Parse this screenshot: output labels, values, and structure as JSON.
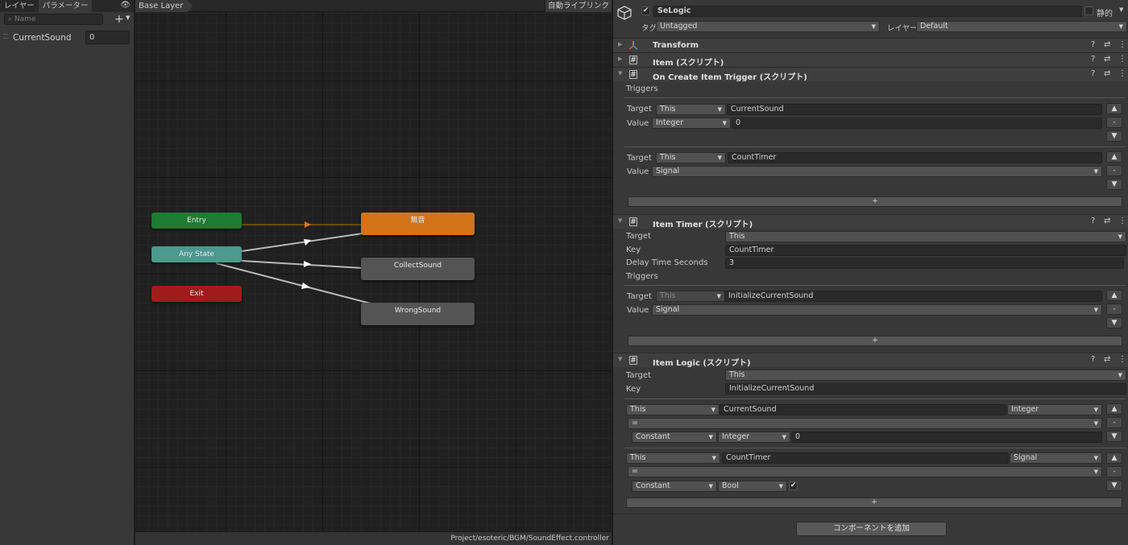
{
  "left_panel": {
    "tab_layers": "レイヤー",
    "tab_parameters": "パラメーター",
    "search_placeholder": "Name",
    "add_label": "+",
    "parameters": [
      {
        "name": "CurrentSound",
        "value": "0"
      }
    ]
  },
  "graph": {
    "breadcrumb": "Base Layer",
    "auto_live_link": "自動ライブリンク",
    "path": "Project/esoteric/BGM/SoundEffect.controller",
    "nodes": {
      "entry": "Entry",
      "any_state": "Any State",
      "exit": "Exit",
      "silent": "無音",
      "collect": "CollectSound",
      "wrong": "WrongSound"
    },
    "colors": {
      "entry": "#1f7a32",
      "any_state": "#4a9a8e",
      "exit": "#a01c1c",
      "default_state": "#d4731a",
      "state": "#545454"
    }
  },
  "inspector": {
    "object_name": "SeLogic",
    "static_label": "静的",
    "tag_label": "タグ",
    "tag_value": "Untagged",
    "layer_label": "レイヤー",
    "layer_value": "Default",
    "components": {
      "transform": "Transform",
      "item": "Item (スクリプト)",
      "on_create": "On Create Item Trigger (スクリプト)",
      "timer": "Item Timer (スクリプト)",
      "logic": "Item Logic (スクリプト)"
    },
    "on_create": {
      "triggers_label": "Triggers",
      "target_label": "Target",
      "value_label": "Value",
      "t1_target": "This",
      "t1_key": "CurrentSound",
      "t1_type": "Integer",
      "t1_value": "0",
      "t2_target": "This",
      "t2_key": "CountTimer",
      "t2_type": "Signal",
      "plus": "+"
    },
    "timer": {
      "target_label": "Target",
      "target_value": "This",
      "key_label": "Key",
      "key_value": "CountTimer",
      "delay_label": "Delay Time Seconds",
      "delay_value": "3",
      "triggers_label": "Triggers",
      "tr_target_label": "Target",
      "tr_target": "This",
      "tr_key": "InitializeCurrentSound",
      "tr_value_label": "Value",
      "tr_type": "Signal",
      "plus": "+"
    },
    "logic": {
      "target_label": "Target",
      "target_value": "This",
      "key_label": "Key",
      "key_value": "InitializeCurrentSound",
      "c1_target": "This",
      "c1_key": "CurrentSound",
      "c1_type": "Integer",
      "c1_op": "=",
      "c1_source": "Constant",
      "c1_vtype": "Integer",
      "c1_value": "0",
      "c2_target": "This",
      "c2_key": "CountTimer",
      "c2_type": "Signal",
      "c2_op": "=",
      "c2_source": "Constant",
      "c2_vtype": "Bool",
      "c2_check": "✔",
      "plus": "+"
    },
    "add_component": "コンポーネントを追加",
    "stepper": {
      "up": "▲",
      "minus": "-",
      "down": "▼"
    },
    "icons": {
      "help": "?",
      "settings": "⇄",
      "more": "⋮"
    }
  }
}
